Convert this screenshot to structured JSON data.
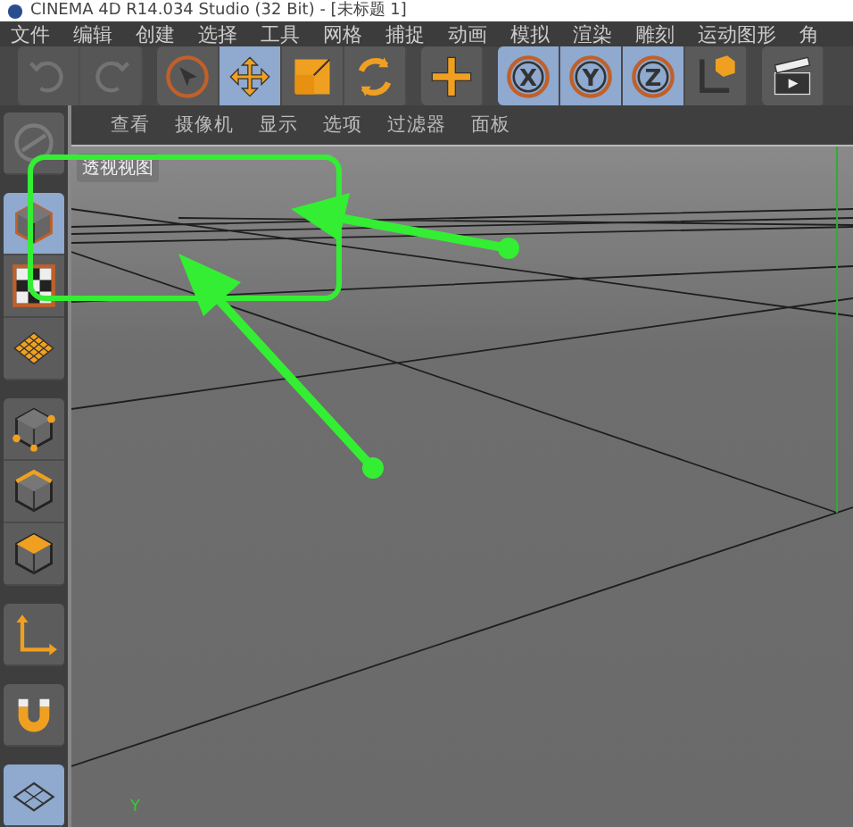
{
  "window": {
    "title": "CINEMA 4D R14.034 Studio (32 Bit) - [未标题 1]"
  },
  "menu": [
    "文件",
    "编辑",
    "创建",
    "选择",
    "工具",
    "网格",
    "捕捉",
    "动画",
    "模拟",
    "渲染",
    "雕刻",
    "运动图形",
    "角"
  ],
  "toolbar": [
    {
      "buttons": [
        {
          "kind": "undo",
          "disabled": true,
          "selected": false
        },
        {
          "kind": "redo",
          "disabled": true,
          "selected": false
        }
      ]
    },
    {
      "buttons": [
        {
          "kind": "select",
          "disabled": false,
          "selected": false
        },
        {
          "kind": "move",
          "disabled": false,
          "selected": true
        },
        {
          "kind": "scale",
          "disabled": false,
          "selected": false
        },
        {
          "kind": "rotate",
          "disabled": false,
          "selected": false
        }
      ]
    },
    {
      "buttons": [
        {
          "kind": "add",
          "disabled": false,
          "selected": false
        }
      ]
    },
    {
      "buttons": [
        {
          "kind": "axis-letter",
          "label": "X",
          "disabled": false,
          "selected": true
        },
        {
          "kind": "axis-letter",
          "label": "Y",
          "disabled": false,
          "selected": true
        },
        {
          "kind": "axis-letter",
          "label": "Z",
          "disabled": false,
          "selected": true
        },
        {
          "kind": "coordinates",
          "disabled": false,
          "selected": false
        }
      ]
    },
    {
      "buttons": [
        {
          "kind": "render",
          "disabled": false,
          "selected": false
        }
      ]
    }
  ],
  "side_tools": [
    {
      "buttons": [
        {
          "kind": "model-disabled",
          "selected": false
        }
      ]
    },
    {
      "buttons": [
        {
          "kind": "cube",
          "selected": true
        },
        {
          "kind": "checker",
          "selected": false
        },
        {
          "kind": "plane",
          "selected": false
        }
      ]
    },
    {
      "buttons": [
        {
          "kind": "points",
          "selected": false
        },
        {
          "kind": "edges",
          "selected": false
        },
        {
          "kind": "polygons",
          "selected": false
        }
      ]
    },
    {
      "buttons": [
        {
          "kind": "axis",
          "selected": false
        }
      ]
    },
    {
      "buttons": [
        {
          "kind": "magnet",
          "selected": false
        }
      ]
    },
    {
      "buttons": [
        {
          "kind": "workplane",
          "selected": true
        }
      ]
    }
  ],
  "viewport": {
    "menu": [
      "查看",
      "摄像机",
      "显示",
      "选项",
      "过滤器",
      "面板"
    ],
    "view_label": "透视视图",
    "axis_label": "Y"
  }
}
